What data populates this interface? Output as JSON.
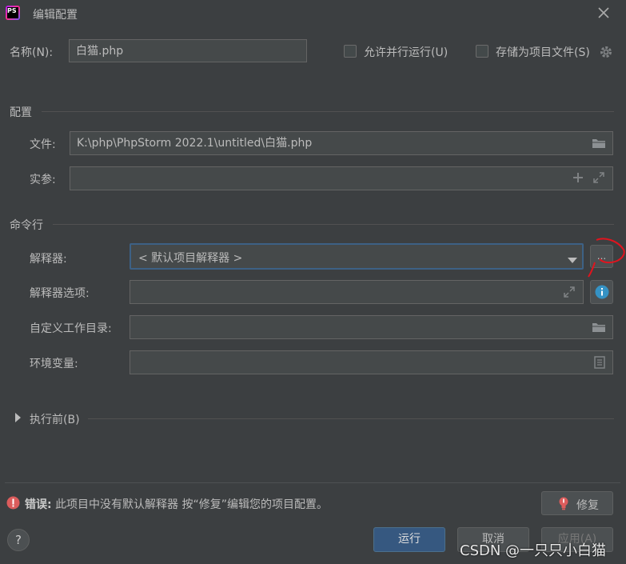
{
  "window": {
    "title": "编辑配置",
    "app_icon_text": "PS"
  },
  "name_row": {
    "label": "名称(N):",
    "value": "白猫.php",
    "allow_parallel_label": "允许并行运行(U)",
    "store_as_file_label": "存储为项目文件(S)"
  },
  "config_section": {
    "title": "配置",
    "file_label": "文件:",
    "file_value": "K:\\php\\PhpStorm 2022.1\\untitled\\白猫.php",
    "args_label": "实参:",
    "args_value": ""
  },
  "cmdline_section": {
    "title": "命令行",
    "interpreter_label": "解释器:",
    "interpreter_value": "< 默认项目解释器 >",
    "browse_button_label": "...",
    "interpreter_options_label": "解释器选项:",
    "workdir_label": "自定义工作目录:",
    "env_label": "环境变量:"
  },
  "before_launch": {
    "label": "执行前(B)"
  },
  "error": {
    "prefix": "错误:",
    "message": "此项目中没有默认解释器 按“修复”编辑您的项目配置。",
    "fix_button": "修复"
  },
  "footer": {
    "help_label": "?",
    "run_button": "运行",
    "cancel_button": "取消",
    "apply_button": "应用(A)",
    "watermark": "CSDN @一只只小白猫"
  },
  "colors": {
    "background": "#3c3f41",
    "field_bg": "#45494a",
    "primary_button": "#365880",
    "error_red": "#db5c5c",
    "info_blue": "#3592c4",
    "annotation_red": "#e0141e"
  }
}
